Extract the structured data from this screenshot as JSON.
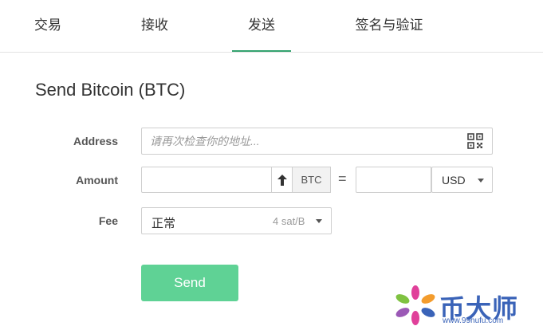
{
  "tabs": [
    {
      "label": "交易",
      "active": false
    },
    {
      "label": "接收",
      "active": false
    },
    {
      "label": "发送",
      "active": true
    },
    {
      "label": "签名与验证",
      "active": false
    }
  ],
  "title": "Send Bitcoin (BTC)",
  "form": {
    "address_label": "Address",
    "address_placeholder": "请再次检查你的地址...",
    "amount_label": "Amount",
    "amount_value": "",
    "amount_unit": "BTC",
    "equals": "=",
    "fiat_value": "",
    "fiat_currency": "USD",
    "fee_label": "Fee",
    "fee_level": "正常",
    "fee_rate": "4 sat/B"
  },
  "send_label": "Send",
  "watermark": {
    "text": "币大师",
    "url": "www.99hufu.com"
  },
  "colors": {
    "accent": "#34a36f",
    "send_button": "#5fd295",
    "watermark": "#3a63b8"
  }
}
